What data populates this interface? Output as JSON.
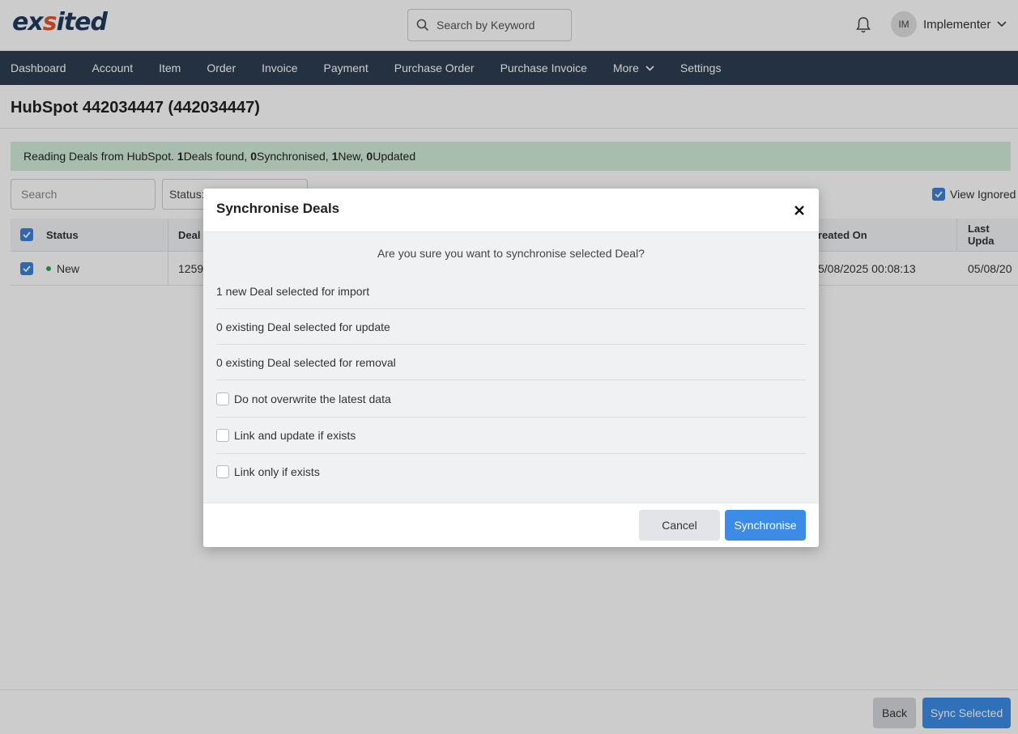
{
  "app": {
    "logo_prefix": "ex",
    "logo_mark": "s",
    "logo_suffix": "ited"
  },
  "header": {
    "search_placeholder": "Search by Keyword",
    "user_initials": "IM",
    "user_name": "Implementer"
  },
  "nav": {
    "items": [
      "Dashboard",
      "Account",
      "Item",
      "Order",
      "Invoice",
      "Payment",
      "Purchase Order",
      "Purchase Invoice",
      "More",
      "Settings"
    ]
  },
  "page": {
    "title": "HubSpot 442034447 (442034447)",
    "alert": {
      "prefix": "Reading Deals from HubSpot. ",
      "found_count": "1",
      "found_label": " Deals found, ",
      "sync_count": "0",
      "sync_label": " Synchronised, ",
      "new_count": "1",
      "new_label": " New, ",
      "updated_count": "0",
      "updated_label": " Updated"
    },
    "filter": {
      "search_placeholder": "Search",
      "status_label": "Status:"
    },
    "view_ignored_label": "View Ignored",
    "table": {
      "columns": {
        "status": "Status",
        "deal": "Deal I",
        "created_on": "reated On",
        "last_updated": "Last Upda"
      },
      "rows": [
        {
          "status": "New",
          "deal": "1259",
          "created_on": "5/08/2025 00:08:13",
          "last_updated": "05/08/20"
        }
      ]
    },
    "footer": {
      "back_label": "Back",
      "sync_selected_label": "Sync Selected"
    }
  },
  "modal": {
    "title": "Synchronise Deals",
    "close_glyph": "×",
    "question": "Are you sure you want to synchronise selected Deal?",
    "summary": [
      "1 new Deal selected for import",
      "0 existing Deal selected for update",
      "0 existing Deal selected for removal"
    ],
    "options": [
      "Do not overwrite the latest data",
      "Link and update if exists",
      "Link only if exists"
    ],
    "cancel_label": "Cancel",
    "sync_label": "Synchronise"
  }
}
